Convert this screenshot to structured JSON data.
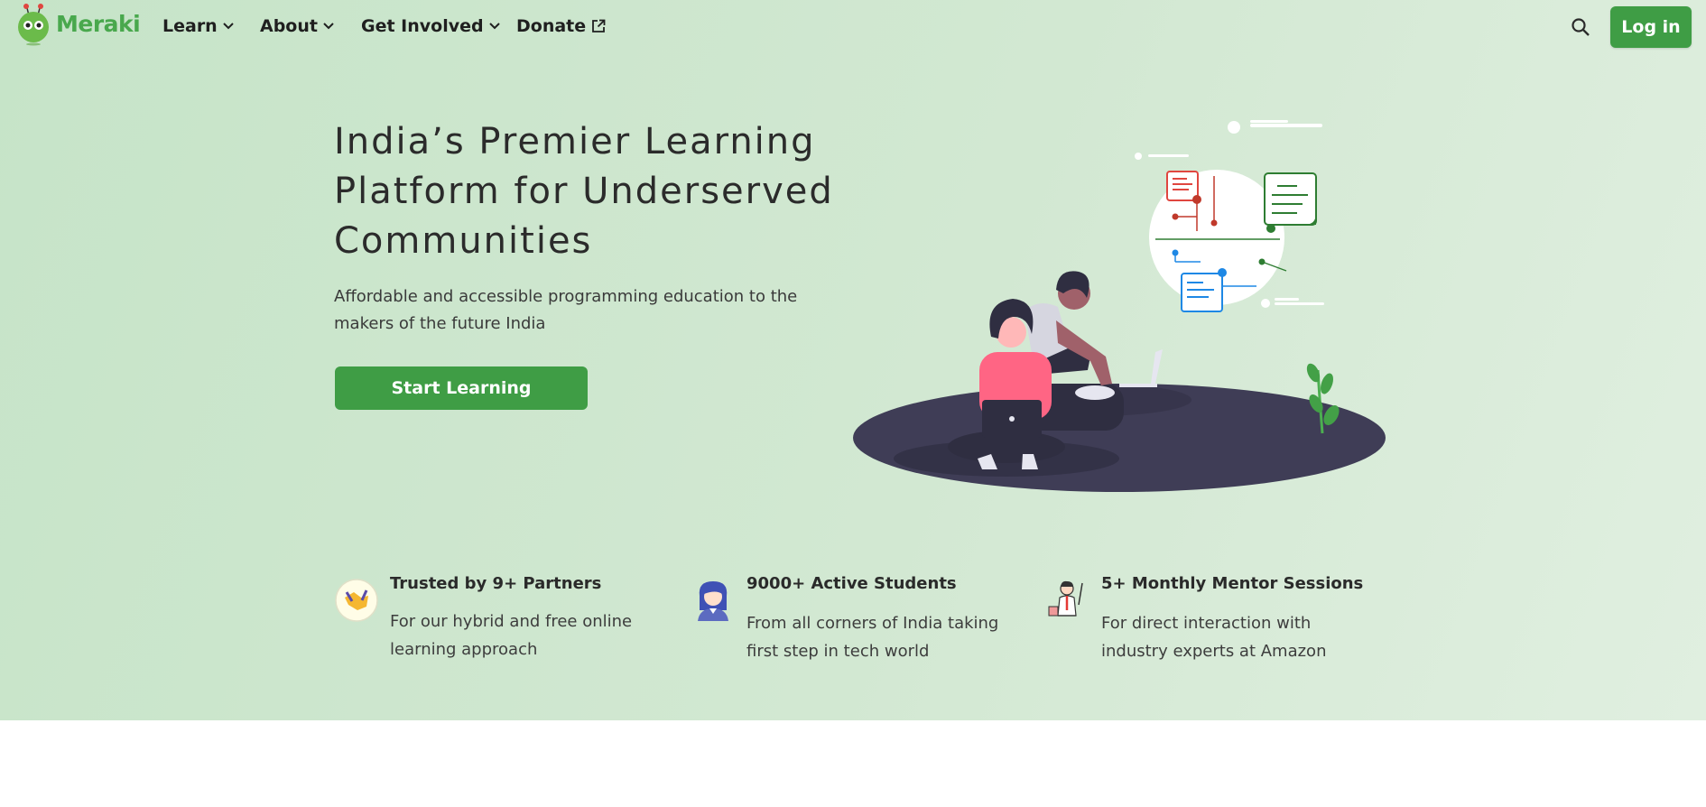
{
  "brand": {
    "name": "Meraki",
    "color": "#49a84d"
  },
  "nav": {
    "items": [
      {
        "label": "Learn",
        "icon": "chevron-down-icon"
      },
      {
        "label": "About",
        "icon": "chevron-down-icon"
      },
      {
        "label": "Get Involved",
        "icon": "chevron-down-icon"
      },
      {
        "label": "Donate",
        "icon": "external-link-icon"
      }
    ],
    "search_icon": "search-icon",
    "login_label": "Log in"
  },
  "hero": {
    "title": "India’s Premier Learning Platform for Underserved Communities",
    "subtitle": "Affordable and accessible programming education to the makers of the future India",
    "cta_label": "Start Learning",
    "accent_color": "#3f9d45"
  },
  "stats": [
    {
      "icon": "handshake-icon",
      "title": "Trusted by 9+ Partners",
      "desc": "For our hybrid and free online learning approach"
    },
    {
      "icon": "student-icon",
      "title": "9000+ Active Students",
      "desc": "From all corners of India taking first step in tech world"
    },
    {
      "icon": "mentor-icon",
      "title": "5+ Monthly Mentor Sessions",
      "desc": "For direct interaction with industry experts at Amazon"
    }
  ]
}
